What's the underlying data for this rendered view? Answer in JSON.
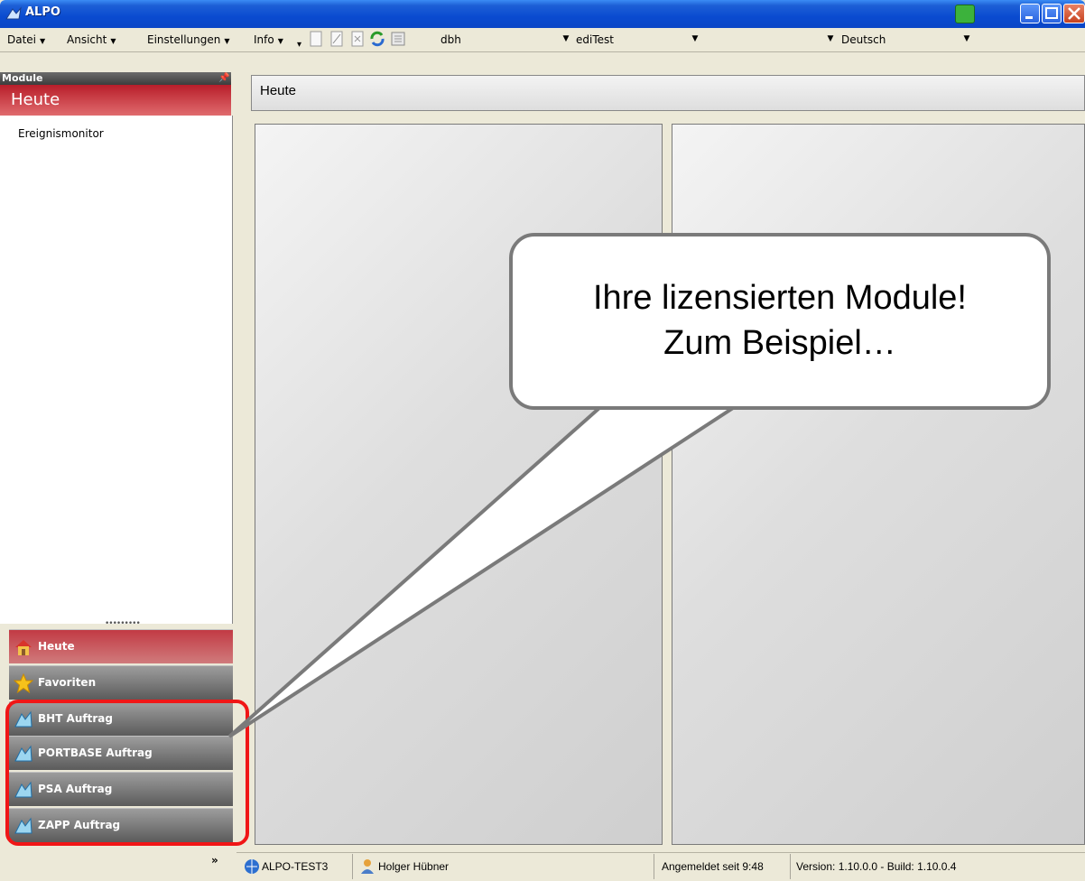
{
  "window": {
    "title": "ALPO"
  },
  "menu": {
    "items": [
      "Datei",
      "Ansicht",
      "Einstellungen",
      "Info"
    ],
    "combo_1": "dbh",
    "combo_2": "ediTest",
    "language": "Deutsch"
  },
  "sidebar": {
    "header": "Module",
    "section_title": "Heute",
    "items": [
      "Ereignismonitor"
    ],
    "nav": [
      {
        "label": "Heute",
        "icon": "home-icon"
      },
      {
        "label": "Favoriten",
        "icon": "star-icon"
      },
      {
        "label": "BHT Auftrag",
        "icon": "module-icon"
      },
      {
        "label": "PORTBASE Auftrag",
        "icon": "module-icon"
      },
      {
        "label": "PSA Auftrag",
        "icon": "module-icon"
      },
      {
        "label": "ZAPP Auftrag",
        "icon": "module-icon"
      }
    ],
    "collapse_chevron": "»"
  },
  "main": {
    "title": "Heute"
  },
  "callout": {
    "line1": "Ihre lizensierten Module!",
    "line2": "Zum Beispiel…"
  },
  "status": {
    "server": "ALPO-TEST3",
    "user": "Holger Hübner",
    "login": "Angemeldet seit 9:48",
    "version": "Version: 1.10.0.0 - Build: 1.10.0.4"
  },
  "colors": {
    "title_blue": "#0a4bd0",
    "accent_red": "#c23a44",
    "highlight_red": "#f01616"
  }
}
